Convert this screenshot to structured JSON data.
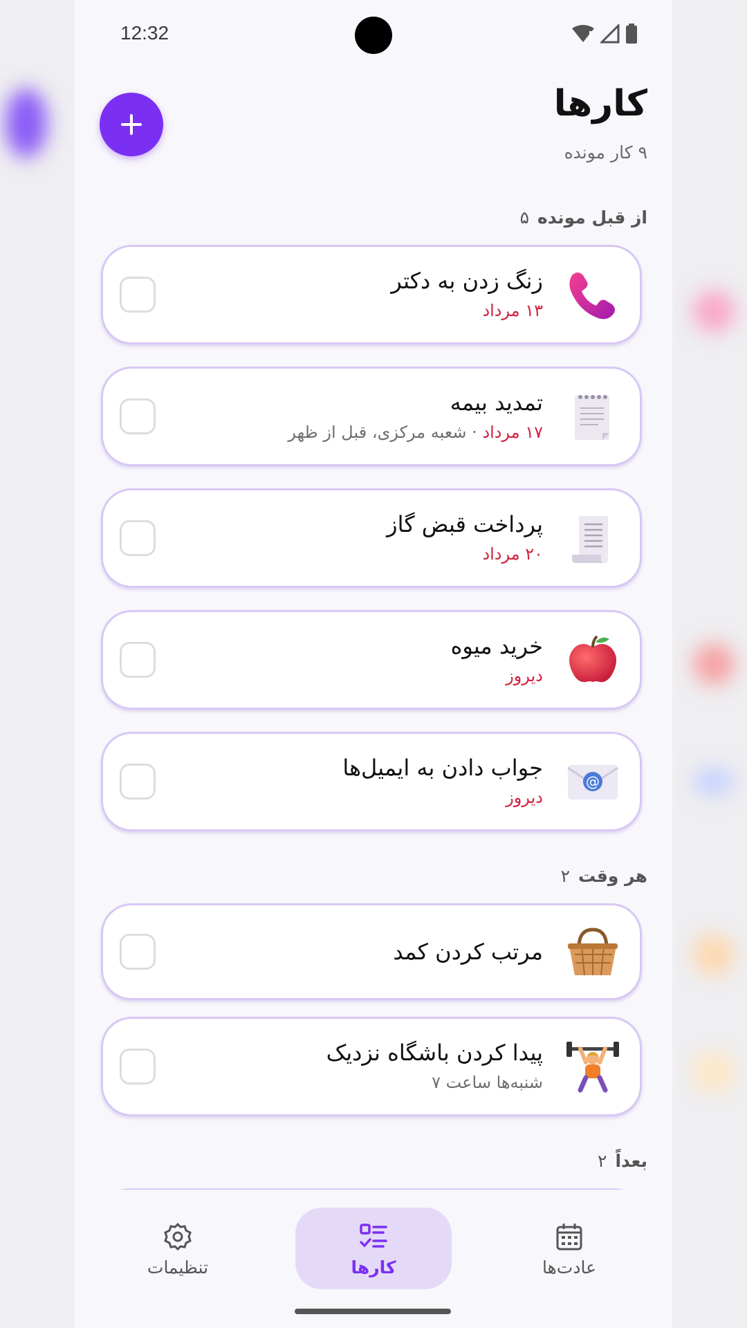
{
  "status": {
    "time": "12:32"
  },
  "header": {
    "title": "کارها",
    "subtitle": "۹ کار مونده"
  },
  "sections": [
    {
      "title": "از قبل مونده",
      "count": "۵",
      "tasks": [
        {
          "title": "زنگ زدن به دکتر",
          "date": "۱۳ مرداد",
          "note": "",
          "icon": "telephone-receiver-icon"
        },
        {
          "title": "تمدید بیمه",
          "date": "۱۷ مرداد",
          "note": " · شعبه مرکزی، قبل از ظهر",
          "icon": "spiral-notepad-icon"
        },
        {
          "title": "پرداخت قبض گاز",
          "date": "۲۰ مرداد",
          "note": "",
          "icon": "receipt-icon"
        },
        {
          "title": "خرید میوه",
          "date": "دیروز",
          "note": "",
          "icon": "red-apple-icon"
        },
        {
          "title": "جواب دادن به ایمیل‌ها",
          "date": "دیروز",
          "note": "",
          "icon": "email-envelope-icon"
        }
      ]
    },
    {
      "title": "هر وقت",
      "count": "۲",
      "tasks": [
        {
          "title": "مرتب کردن کمد",
          "date": "",
          "note": "",
          "icon": "basket-icon"
        },
        {
          "title": "پیدا کردن باشگاه نزدیک",
          "date": "",
          "note": "شنبه‌ها ساعت ۷",
          "icon": "weightlifter-icon"
        }
      ]
    },
    {
      "title": "بعداً",
      "count": "۲",
      "tasks": []
    }
  ],
  "nav": {
    "settings_label": "تنظیمات",
    "tasks_label": "کارها",
    "habits_label": "عادت‌ها",
    "active": "tasks"
  },
  "colors": {
    "accent": "#7b2ff2",
    "overdue": "#d0223e",
    "card_border": "#d8c8f5",
    "nav_active_bg": "#e4daf8"
  }
}
